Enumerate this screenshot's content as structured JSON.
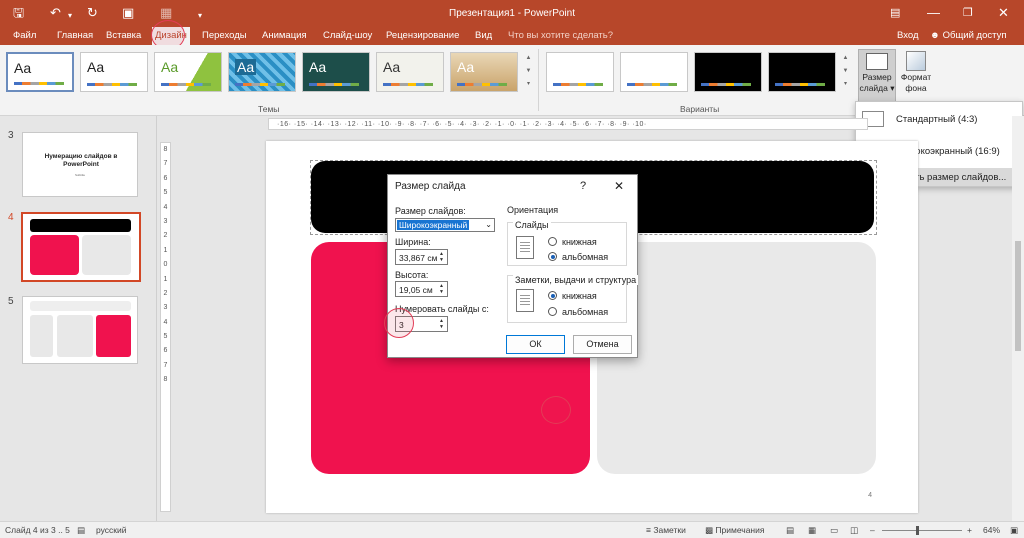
{
  "app": {
    "title": "Презентация1 - PowerPoint",
    "sign_in": "Вход",
    "share": "Общий доступ",
    "tell_me": "Что вы хотите сделать?"
  },
  "tabs": [
    "Файл",
    "Главная",
    "Вставка",
    "Дизайн",
    "Переходы",
    "Анимация",
    "Слайд-шоу",
    "Рецензирование",
    "Вид"
  ],
  "ribbon": {
    "themes_label": "Темы",
    "variants_label": "Варианты",
    "theme_sample": "Aa",
    "slide_size_label": "Размер слайда",
    "background_format_label": "Формат фона"
  },
  "size_menu": {
    "standard": "Стандартный (4:3)",
    "widescreen": "Широкоэкранный (16:9)",
    "custom": "Настроить размер слайдов..."
  },
  "thumbnails": {
    "n3": "3",
    "n4": "4",
    "n5": "5",
    "slide3_title": "Нумерацию слайдов в PowerPoint",
    "slide3_sub": "Subtitle"
  },
  "ruler": {
    "h": "·16· ·15· ·14· ·13· ·12· ·11· ·10· ·9· ·8· ·7· ·6· ·5· ·4· ·3· ·2· ·1· ·0· ·1· ·2· ·3· ·4· ·5· ·6· ·7· ·8· ·9· ·10·",
    "v": [
      "8",
      "7",
      "6",
      "5",
      "4",
      "3",
      "2",
      "1",
      "0",
      "1",
      "2",
      "3",
      "4",
      "5",
      "6",
      "7",
      "8"
    ]
  },
  "slide": {
    "number": "4"
  },
  "dialog": {
    "title": "Размер слайда",
    "help": "?",
    "slide_size_label": "Размер слайдов:",
    "slide_size_value": "Широкоэкранный",
    "width_label": "Ширина:",
    "width_value": "33,867 см",
    "height_label": "Высота:",
    "height_value": "19,05 см",
    "number_from_label": "Нумеровать слайды с:",
    "number_from_value": "3",
    "orientation_label": "Ориентация",
    "slides_group": "Слайды",
    "portrait": "книжная",
    "landscape": "альбомная",
    "notes_group": "Заметки, выдачи и структура",
    "notes_portrait": "книжная",
    "notes_landscape": "альбомная",
    "ok": "ОК",
    "cancel": "Отмена"
  },
  "status": {
    "slide_of": "Слайд 4 из 3 .. 5",
    "language": "русский",
    "notes": "Заметки",
    "comments": "Примечания",
    "zoom": "64%"
  },
  "colors": {
    "accent": "#b7472a",
    "pink": "#f0124e",
    "dialog_sel": "#1874d2"
  }
}
